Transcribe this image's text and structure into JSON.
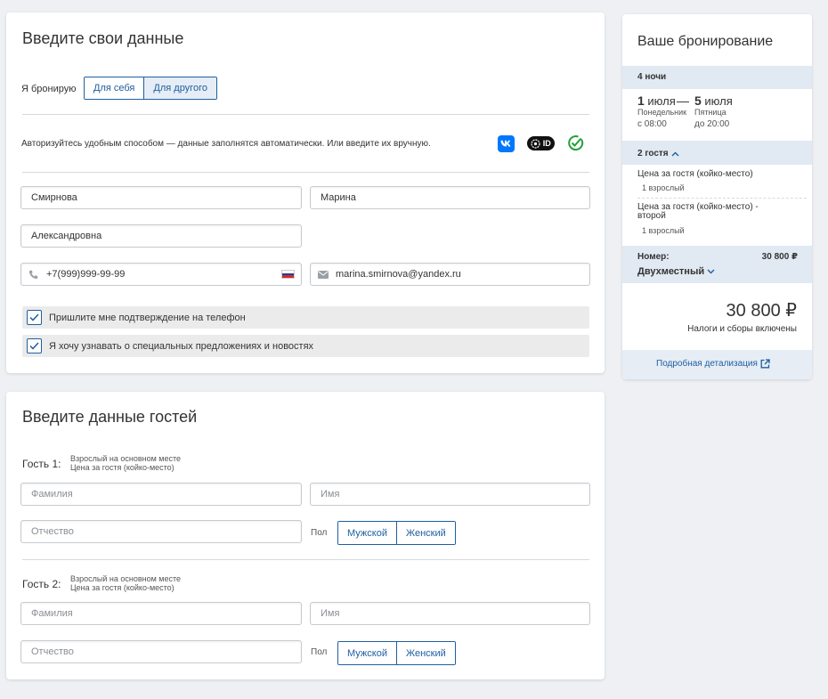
{
  "personal": {
    "title": "Введите свои данные",
    "booking_for_label": "Я бронирую",
    "booking_for_options": [
      "Для себя",
      "Для другого"
    ],
    "auth_text": "Авторизуйтесь удобным способом — данные заполнятся автоматически. Или введите их вручную.",
    "auth_icons": [
      "vk-icon",
      "sber-id-icon",
      "gosuslugi-check-icon"
    ],
    "last_name": "Смирнова",
    "first_name": "Марина",
    "middle_name": "Александровна",
    "phone": "+7(999)999-99-99",
    "email": "marina.smirnova@yandex.ru",
    "checks": [
      {
        "label": "Пришлите мне подтверждение на телефон",
        "checked": true
      },
      {
        "label": "Я хочу узнавать о специальных предложениях и новостях",
        "checked": true
      }
    ]
  },
  "guests": {
    "title": "Введите данные гостей",
    "list": [
      {
        "label": "Гость 1:",
        "sub1": "Взрослый на основном месте",
        "sub2": "Цена за гостя (койко-место)",
        "last_name_ph": "Фамилия",
        "first_name_ph": "Имя",
        "middle_name_ph": "Отчество",
        "sex_label": "Пол",
        "sex_options": [
          "Мужской",
          "Женский"
        ]
      },
      {
        "label": "Гость 2:",
        "sub1": "Взрослый на основном месте",
        "sub2": "Цена за гостя (койко-место)",
        "last_name_ph": "Фамилия",
        "first_name_ph": "Имя",
        "middle_name_ph": "Отчество",
        "sex_label": "Пол",
        "sex_options": [
          "Мужской",
          "Женский"
        ]
      }
    ]
  },
  "booking": {
    "title": "Ваше бронирование",
    "nights": "4 ночи",
    "checkin_day": "1",
    "checkin_month": "июля",
    "dash": "—",
    "checkout_day": "5",
    "checkout_month": "июля",
    "checkin_weekday": "Понедельник",
    "checkout_weekday": "Пятница",
    "checkin_time": "с 08:00",
    "checkout_time": "до 20:00",
    "guests_toggle": "2 гостя",
    "guest_prices": [
      {
        "title": "Цена за гостя (койко-место)",
        "sub": "1 взрослый"
      },
      {
        "title": "Цена за гостя (койко-место) - второй",
        "sub": "1 взрослый"
      }
    ],
    "room_label": "Номер:",
    "room_price": "30 800 ₽",
    "room_type": "Двухместный",
    "total": "30 800 ₽",
    "taxes_note": "Налоги и сборы включены",
    "details_link": "Подробная детализация"
  },
  "colors": {
    "accent": "#1f5fa0",
    "background": "#eef0f4",
    "band": "#e1e9f3",
    "vk": "#0077ff",
    "check_green": "#21a038"
  }
}
